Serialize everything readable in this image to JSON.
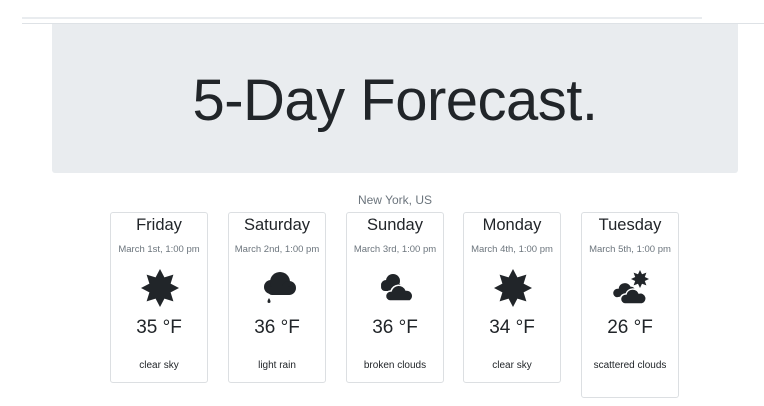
{
  "header": {
    "title": "5-Day Forecast."
  },
  "location": "New York, US",
  "forecast": [
    {
      "day": "Friday",
      "date": "March 1st, 1:00 pm",
      "icon": "sun-icon",
      "temp": "35 °F",
      "description": "clear sky"
    },
    {
      "day": "Saturday",
      "date": "March 2nd, 1:00 pm",
      "icon": "rain-cloud-icon",
      "temp": "36 °F",
      "description": "light rain"
    },
    {
      "day": "Sunday",
      "date": "March 3rd, 1:00 pm",
      "icon": "clouds-icon",
      "temp": "36 °F",
      "description": "broken clouds"
    },
    {
      "day": "Monday",
      "date": "March 4th, 1:00 pm",
      "icon": "sun-icon",
      "temp": "34 °F",
      "description": "clear sky"
    },
    {
      "day": "Tuesday",
      "date": "March 5th, 1:00 pm",
      "icon": "sun-behind-clouds-icon",
      "temp": "26 °F",
      "description": "scattered clouds"
    }
  ],
  "colors": {
    "jumbotron_bg": "#e9ecef",
    "text": "#212529",
    "muted": "#6c757d",
    "card_border": "#dcdfe2"
  }
}
